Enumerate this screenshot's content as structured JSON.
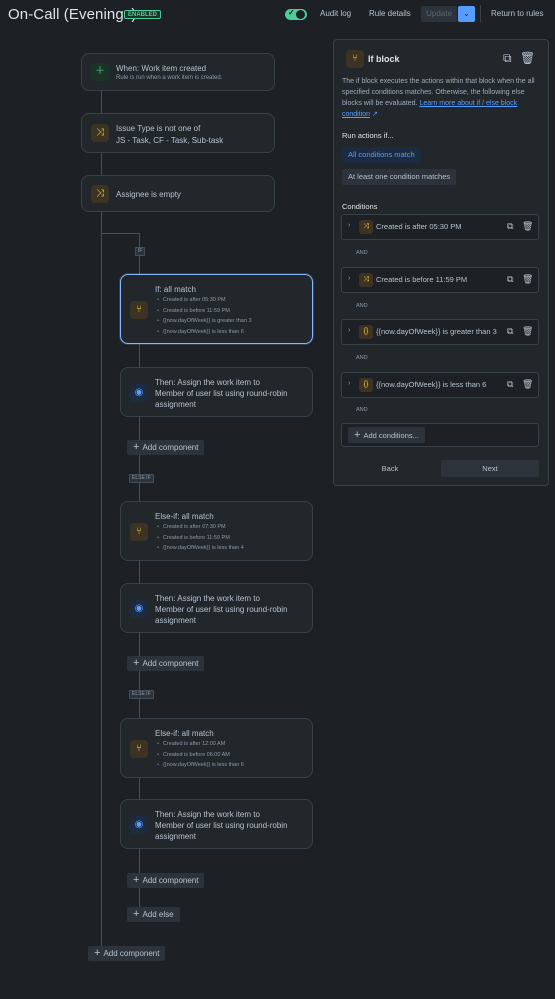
{
  "header": {
    "title": "On-Call (Evenings)",
    "badge": "ENABLED",
    "toggle_check": "✓",
    "audit_log": "Audit log",
    "rule_details": "Rule details",
    "update": "Update",
    "update_menu": "⌄",
    "return": "Return to rules"
  },
  "trigger": {
    "title": "When: Work item created",
    "subtitle": "Rule is run when a work item is created.",
    "icon": "plus-icon"
  },
  "condition1": {
    "title": "Issue Type is not one of",
    "subtitle": "JS - Task, CF - Task, Sub-task",
    "icon": "shuffle-icon"
  },
  "condition2": {
    "title": "Assignee is empty",
    "icon": "shuffle-icon"
  },
  "branch_tag": "IF",
  "if_block": {
    "title": "If: all match",
    "conditions": [
      "Created is after 05:30 PM",
      "Created is before 11:59 PM",
      "{{now.dayOfWeek}} is greater than 3",
      "{{now.dayOfWeek}} is less than 6"
    ]
  },
  "action1": {
    "title": "Then: Assign the work item to",
    "line2": "Member of user list using round-robin",
    "line3": "assignment"
  },
  "add_component_1": "Add component",
  "else_tag_1": "ELSE IF",
  "elseif1": {
    "title": "Else-if: all match",
    "conditions": [
      "Created is after 07:30 PM",
      "Created is before 11:59 PM",
      "{{now.dayOfWeek}} is less than 4"
    ]
  },
  "action2": {
    "title": "Then: Assign the work item to",
    "line2": "Member of user list using round-robin",
    "line3": "assignment"
  },
  "add_component_2": "Add component",
  "else_tag_2": "ELSE IF",
  "elseif2": {
    "title": "Else-if: all match",
    "conditions": [
      "Created is after 12:00 AM",
      "Created is before 06:00 AM",
      "{{now.dayOfWeek}} is less than 6"
    ]
  },
  "action3": {
    "title": "Then: Assign the work item to",
    "line2": "Member of user list using round-robin",
    "line3": "assignment"
  },
  "add_component_3": "Add component",
  "add_else": "Add else",
  "add_component_main": "Add component",
  "panel": {
    "title": "If block",
    "description": "The if block executes the actions within that block when the all specified conditions matches. Otherwise, the following else blocks will be evaluated.",
    "link": "Learn more about if / else block condition",
    "run_actions_label": "Run actions if...",
    "option_all": "All conditions match",
    "option_any": "At least one condition matches",
    "conditions_label": "Conditions",
    "conditions": [
      {
        "text": "Created is after 05:30 PM",
        "icon": "shuffle-icon"
      },
      {
        "text": "Created is before 11:59 PM",
        "icon": "shuffle-icon"
      },
      {
        "text": "{{now.dayOfWeek}} is greater than 3",
        "icon": "braces-icon"
      },
      {
        "text": "{{now.dayOfWeek}} is less than 6",
        "icon": "braces-icon"
      }
    ],
    "and_label": "AND",
    "add_conditions": "Add conditions...",
    "back": "Back",
    "next": "Next"
  },
  "colors": {
    "background": "#1d2125",
    "card": "#22272b",
    "accent": "#579dff",
    "success": "#4bce97",
    "warning": "#f5cd47"
  }
}
